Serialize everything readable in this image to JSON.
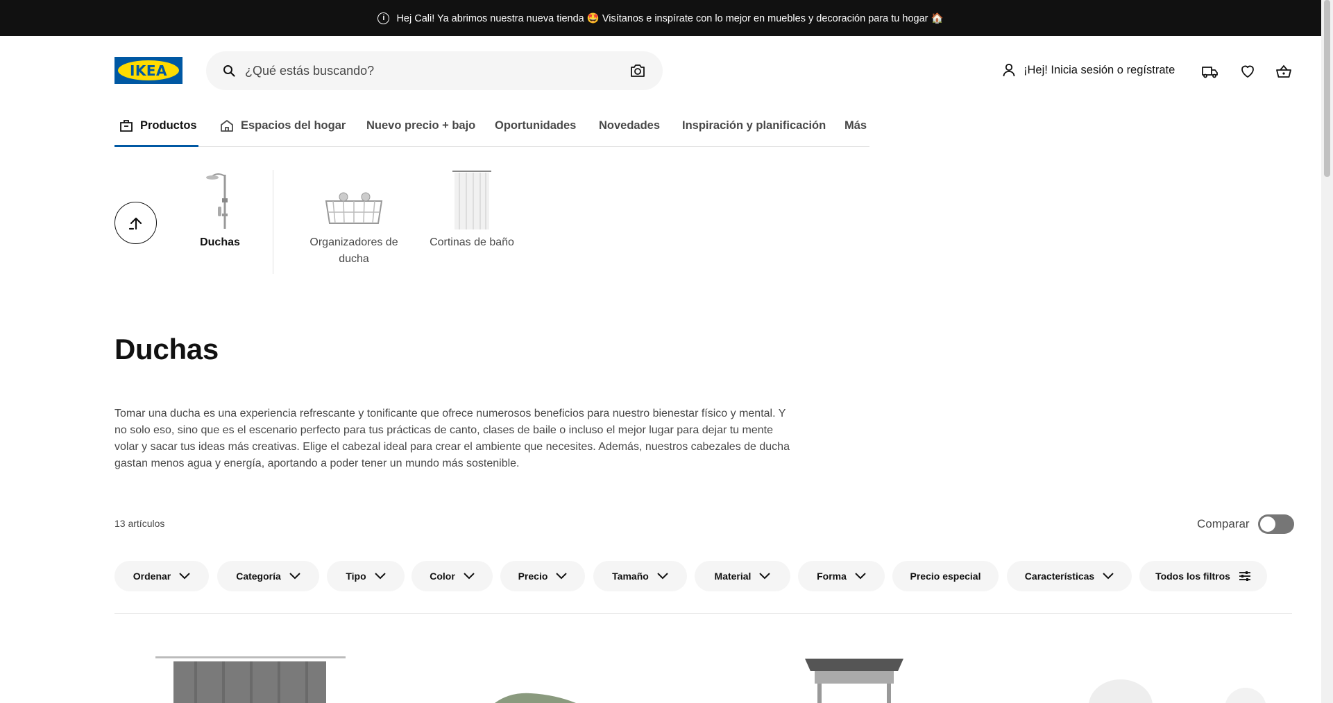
{
  "banner": {
    "text": "Hej Cali! Ya abrimos nuestra nueva tienda 🤩 Visítanos e inspírate con lo mejor en muebles y decoración para tu hogar 🏠"
  },
  "header": {
    "logo_text": "IKEA",
    "search_placeholder": "¿Qué estás buscando?",
    "account_label": "¡Hej! Inicia sesión o regístrate"
  },
  "nav": [
    {
      "label": "Productos"
    },
    {
      "label": "Espacios del hogar"
    },
    {
      "label": "Nuevo precio + bajo"
    },
    {
      "label": "Oportunidades"
    },
    {
      "label": "Novedades"
    },
    {
      "label": "Inspiración y planificación"
    },
    {
      "label": "Más"
    }
  ],
  "categories": [
    {
      "label": "Duchas"
    },
    {
      "label": "Organizadores de ducha"
    },
    {
      "label": "Cortinas de baño"
    }
  ],
  "page": {
    "title": "Duchas",
    "description": "Tomar una ducha es una experiencia refrescante y tonificante que ofrece numerosos beneficios para nuestro bienestar físico y mental. Y no solo eso, sino que es el escenario perfecto para tus prácticas de canto, clases de baile o incluso el mejor lugar para dejar tu mente volar y sacar tus ideas más creativas. Elige el cabezal ideal para crear el ambiente que necesites. Además, nuestros cabezales de ducha gastan menos agua y energía, aportando a poder tener un mundo más sostenible.",
    "item_count": "13 artículos",
    "compare_label": "Comparar"
  },
  "filters": [
    {
      "label": "Ordenar"
    },
    {
      "label": "Categoría"
    },
    {
      "label": "Tipo"
    },
    {
      "label": "Color"
    },
    {
      "label": "Precio"
    },
    {
      "label": "Tamaño"
    },
    {
      "label": "Material"
    },
    {
      "label": "Forma"
    },
    {
      "label": "Precio especial"
    },
    {
      "label": "Características"
    },
    {
      "label": "Todos los filtros"
    }
  ],
  "colors": {
    "brand_blue": "#0058a3",
    "brand_yellow": "#ffdb00",
    "banner_bg": "#111111"
  }
}
